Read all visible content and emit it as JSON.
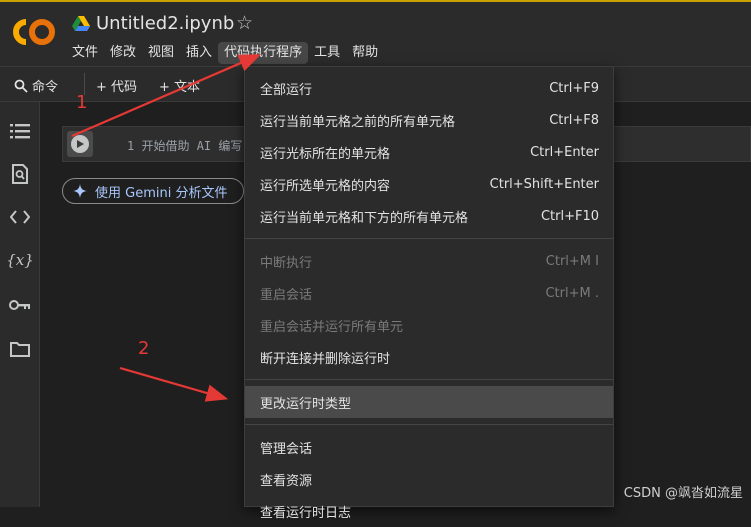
{
  "header": {
    "logo_text": "CO",
    "title": "Untitled2.ipynb",
    "menu": [
      "文件",
      "修改",
      "视图",
      "插入",
      "代码执行程序",
      "工具",
      "帮助"
    ],
    "active_menu_index": 4
  },
  "toolbar": {
    "command_label": "命令",
    "code_label": "+ 代码",
    "text_label": "+ 文本"
  },
  "cell": {
    "line_number": "1",
    "placeholder": "开始借助 AI 编写"
  },
  "gemini": {
    "label": "使用 Gemini 分析文件"
  },
  "dropdown": {
    "items": [
      {
        "label": "全部运行",
        "shortcut": "Ctrl+F9",
        "disabled": false
      },
      {
        "label": "运行当前单元格之前的所有单元格",
        "shortcut": "Ctrl+F8",
        "disabled": false
      },
      {
        "label": "运行光标所在的单元格",
        "shortcut": "Ctrl+Enter",
        "disabled": false
      },
      {
        "label": "运行所选单元格的内容",
        "shortcut": "Ctrl+Shift+Enter",
        "disabled": false
      },
      {
        "label": "运行当前单元格和下方的所有单元格",
        "shortcut": "Ctrl+F10",
        "disabled": false
      },
      {
        "label": "中断执行",
        "shortcut": "Ctrl+M I",
        "disabled": true
      },
      {
        "label": "重启会话",
        "shortcut": "Ctrl+M .",
        "disabled": true
      },
      {
        "label": "重启会话并运行所有单元",
        "shortcut": "",
        "disabled": true
      },
      {
        "label": "断开连接并删除运行时",
        "shortcut": "",
        "disabled": false
      },
      {
        "label": "更改运行时类型",
        "shortcut": "",
        "disabled": false,
        "highlighted": true
      },
      {
        "label": "管理会话",
        "shortcut": "",
        "disabled": false
      },
      {
        "label": "查看资源",
        "shortcut": "",
        "disabled": false
      },
      {
        "label": "查看运行时日志",
        "shortcut": "",
        "disabled": false
      }
    ]
  },
  "annotations": {
    "label_1": "1",
    "label_2": "2",
    "arrow_color": "#e53935"
  },
  "watermark": "CSDN @飒沓如流星",
  "colors": {
    "background": "#1f1f1f",
    "panel": "#2b2b2b",
    "accent": "#a8c7fa",
    "logo_orange": "#f9ab00",
    "logo_yellow": "#e8710a"
  }
}
